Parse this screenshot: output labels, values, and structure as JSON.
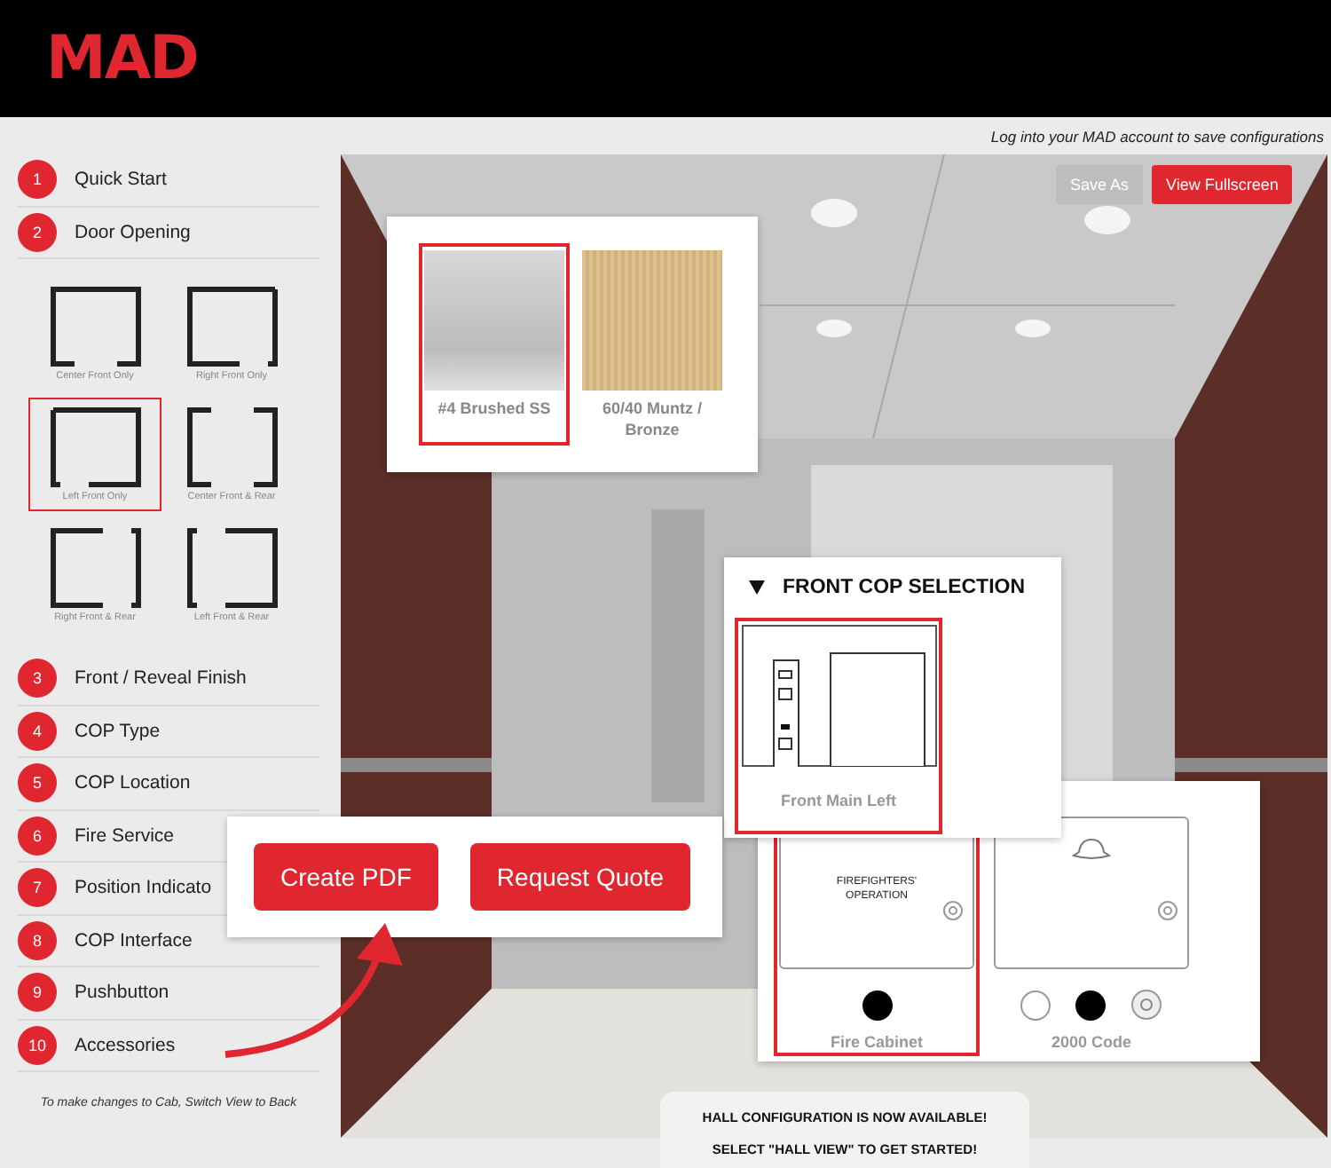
{
  "header": {
    "logo": "MAD"
  },
  "login_note": "Log into your MAD account to save configurations",
  "steps": [
    {
      "number": "1",
      "label": "Quick Start"
    },
    {
      "number": "2",
      "label": "Door Opening",
      "options": [
        {
          "label": "Center Front Only",
          "kind": "center_front",
          "selected": false
        },
        {
          "label": "Right Front Only",
          "kind": "right_front",
          "selected": false
        },
        {
          "label": "Left Front Only",
          "kind": "left_front",
          "selected": true
        },
        {
          "label": "Center Front & Rear",
          "kind": "center_front_rear",
          "selected": false
        },
        {
          "label": "Right Front & Rear",
          "kind": "right_front_rear",
          "selected": false
        },
        {
          "label": "Left Front & Rear",
          "kind": "left_front_rear",
          "selected": false
        }
      ]
    },
    {
      "number": "3",
      "label": "Front / Reveal Finish"
    },
    {
      "number": "4",
      "label": "COP Type"
    },
    {
      "number": "5",
      "label": "COP Location"
    },
    {
      "number": "6",
      "label": "Fire Service"
    },
    {
      "number": "7",
      "label": "Position Indicato"
    },
    {
      "number": "8",
      "label": "COP Interface"
    },
    {
      "number": "9",
      "label": "Pushbutton"
    },
    {
      "number": "10",
      "label": "Accessories"
    }
  ],
  "sidebar_note": "To make changes to Cab, Switch View to Back",
  "viewer": {
    "buttons": [
      {
        "label": "Save As",
        "disabled": true
      },
      {
        "label": "View Fullscreen",
        "disabled": false
      }
    ]
  },
  "finish_options": [
    {
      "label": "#4 Brushed SS",
      "kind": "brushed",
      "selected": true
    },
    {
      "label": "60/40 Muntz / Bronze",
      "kind": "bronze",
      "selected": false
    }
  ],
  "cop_selection": {
    "title": "FRONT COP SELECTION",
    "expanded": true,
    "options": [
      {
        "label": "Front Main Left",
        "selected": true
      }
    ]
  },
  "fire_service_options": [
    {
      "label": "Fire Cabinet",
      "kind": "cabinet",
      "panel_text": "FIREFIGHTERS' OPERATION",
      "selected": true
    },
    {
      "label": "2000 Code",
      "kind": "code_2000",
      "selected": false
    }
  ],
  "actions": [
    {
      "label": "Create PDF"
    },
    {
      "label": "Request Quote"
    }
  ],
  "hall_banner": {
    "line_1": "HALL CONFIGURATION IS NOW AVAILABLE!",
    "line_2": "SELECT \"HALL VIEW\" TO GET STARTED!"
  }
}
